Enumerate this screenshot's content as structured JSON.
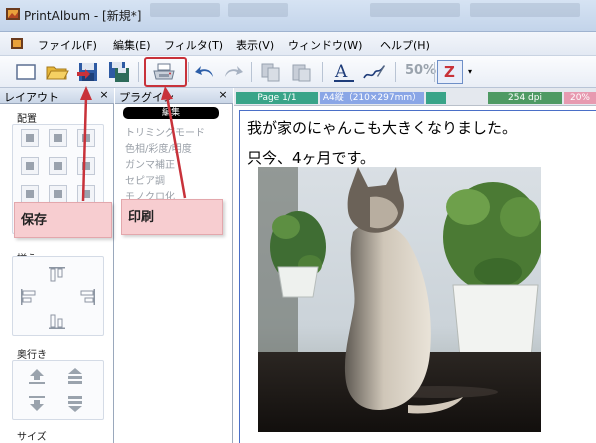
{
  "window": {
    "title": "PrintAlbum - [新規*]"
  },
  "menubar": {
    "items": [
      "ファイル(F)",
      "編集(E)",
      "フィルタ(T)",
      "表示(V)",
      "ウィンドウ(W)",
      "ヘルプ(H)"
    ]
  },
  "toolbar": {
    "zoom_label": "50%",
    "z_label": "Z",
    "text_tool_label": "A"
  },
  "layout_panel": {
    "title": "レイアウト",
    "close": "×",
    "sections": {
      "placement": "配置",
      "align": "揃え",
      "depth": "奥行き",
      "size": "サイズ"
    }
  },
  "plugin_panel": {
    "title": "プラグイン",
    "close": "×",
    "category": "編集",
    "items": [
      "トリミングモード",
      "色相/彩度/明度",
      "ガンマ補正",
      "セピア調",
      "モノクロ化"
    ]
  },
  "document": {
    "status": {
      "page": "Page 1/1",
      "paper": "A4縦（210×297mm）",
      "dpi": "254 dpi",
      "zoom": "20%"
    },
    "lines": [
      "我が家のにゃんこも大きくなりました。",
      "只今、4ヶ月です。"
    ]
  },
  "annotations": {
    "save": "保存",
    "print": "印刷"
  },
  "colors": {
    "accent_red": "#c8323a",
    "callout_bg": "#f7cdd0",
    "status_teal": "#39a488",
    "status_blue": "#8aa6e6",
    "status_green": "#4e9a63",
    "status_pink": "#e79ab0"
  }
}
